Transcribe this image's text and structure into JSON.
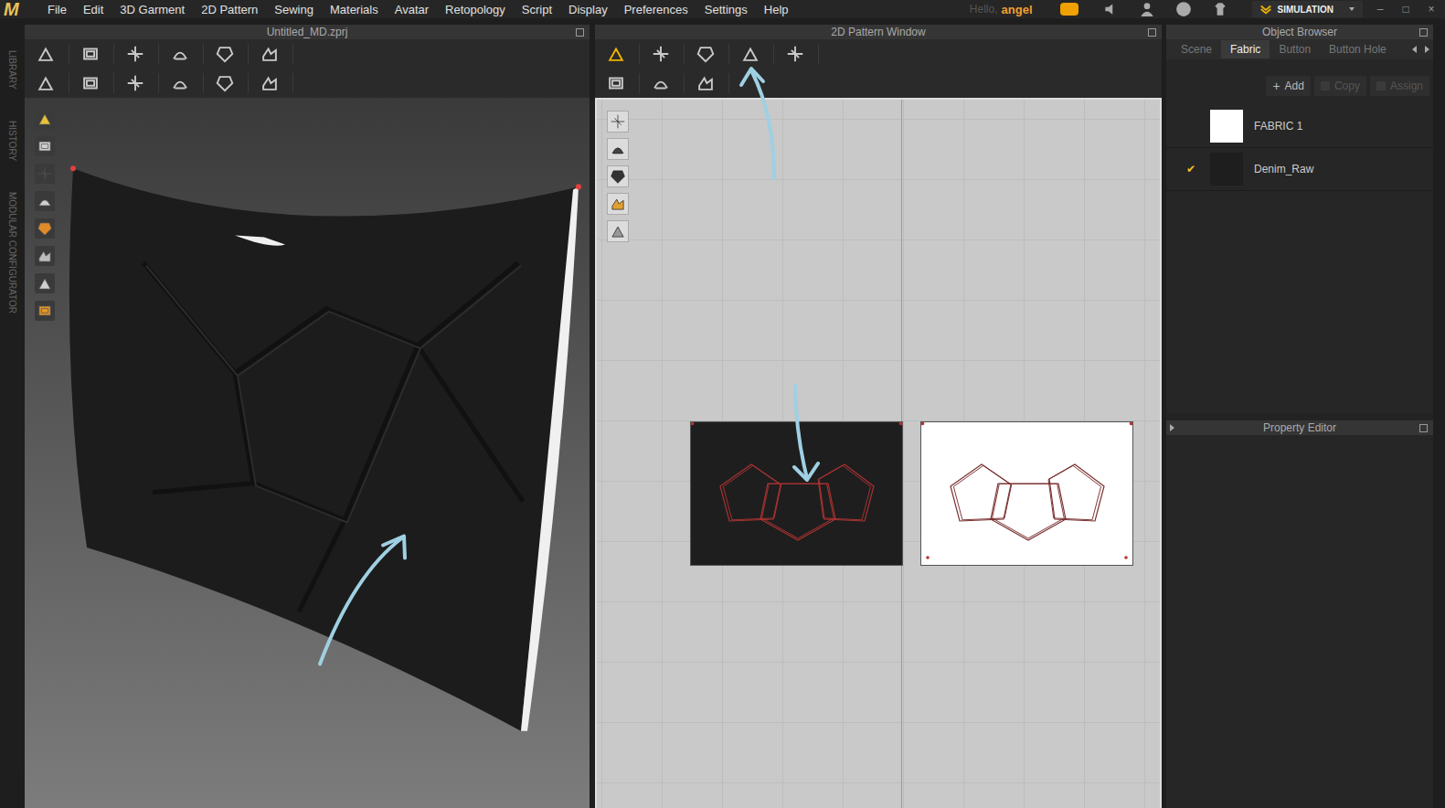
{
  "app": {
    "logo": "M",
    "menu": [
      "File",
      "Edit",
      "3D Garment",
      "2D Pattern",
      "Sewing",
      "Materials",
      "Avatar",
      "Retopology",
      "Script",
      "Display",
      "Preferences",
      "Settings",
      "Help"
    ],
    "greeting": {
      "prefix": "Hello,",
      "name": "angel"
    },
    "simulation": "SIMULATION",
    "window_controls": [
      "–",
      "□",
      "×"
    ]
  },
  "side_tabs": [
    "LIBRARY",
    "HISTORY",
    "MODULAR CONFIGURATOR"
  ],
  "viewport_3d": {
    "title": "Untitled_MD.zprj"
  },
  "pattern_window": {
    "title": "2D Pattern Window",
    "pieces": [
      {
        "fabric": "Denim_Raw",
        "color": "#1e1e1e",
        "selected": true
      },
      {
        "fabric": "FABRIC 1",
        "color": "#ffffff",
        "selected": false
      }
    ]
  },
  "object_browser": {
    "title": "Object Browser",
    "tabs": [
      {
        "label": "Scene",
        "selected": false
      },
      {
        "label": "Fabric",
        "selected": true
      },
      {
        "label": "Button",
        "selected": false
      },
      {
        "label": "Button Hole",
        "selected": false
      }
    ],
    "actions": [
      {
        "icon": "+",
        "label": "Add",
        "disabled": false
      },
      {
        "icon": "",
        "label": "Copy",
        "disabled": true
      },
      {
        "icon": "",
        "label": "Assign",
        "disabled": true
      }
    ],
    "check": "✔",
    "fabrics": [
      {
        "name": "FABRIC 1",
        "color": "#ffffff",
        "checked": false
      },
      {
        "name": "Denim_Raw",
        "color": "#1e1e1e",
        "checked": true
      }
    ]
  },
  "property_editor": {
    "title": "Property Editor"
  }
}
